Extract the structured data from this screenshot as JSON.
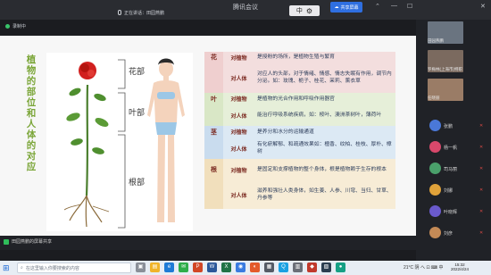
{
  "window": {
    "title": "腾讯会议",
    "speaking": "正在讲话：田园燕鹏",
    "mini_bar_char": "中",
    "share_label": "共享屏幕"
  },
  "sidebar_ctrl": "录制中",
  "slide": {
    "title": "植物的部位和人体的对应",
    "tags": [
      "花部",
      "叶部",
      "根部"
    ]
  },
  "table": {
    "rows": [
      {
        "part": "花",
        "sub": "对植物",
        "desc": "是授粉的场所，是植物生殖与繁育"
      },
      {
        "part": "",
        "sub": "对人体",
        "desc": "对应人的头部，对于情绪、情感、情志失眠有作用，调节内分泌。如：玫瑰、栀子、桂花、茉莉、薰衣草"
      },
      {
        "part": "叶",
        "sub": "对植物",
        "desc": "是植物的光合作用和呼吸作用器官"
      },
      {
        "part": "",
        "sub": "对人体",
        "desc": "能治疗呼吸系统疾病，如：桉叶、澳洲茶树叶，薄荷叶"
      },
      {
        "part": "茎",
        "sub": "对植物",
        "desc": "是养分和水分的运输通道"
      },
      {
        "part": "",
        "sub": "对人体",
        "desc": "有化瘀解郁、和疏通效果如：檀香、纹柏、桂枝、厚朴、樟树"
      },
      {
        "part": "根",
        "sub": "对植物",
        "desc": "是固定和支撑植物的整个身体，根是植物赖于生存的根本"
      },
      {
        "part": "",
        "sub": "对人体",
        "desc": "滋养和强壮人类身体，如生姜、人参、川穹、当归、甘草、丹参等"
      }
    ]
  },
  "participants": [
    {
      "name": "田园燕鹏",
      "kind": "video"
    },
    {
      "name": "罗梅林(上海市)特职",
      "kind": "video"
    },
    {
      "name": "任晓丽",
      "kind": "video"
    },
    {
      "name": "张鹏",
      "kind": "avatar",
      "color": "#4a78d8"
    },
    {
      "name": "杨一帆",
      "kind": "avatar",
      "color": "#d8486b"
    },
    {
      "name": "司马丽",
      "kind": "avatar",
      "color": "#4aa06b"
    },
    {
      "name": "刘娜",
      "kind": "avatar",
      "color": "#e0a23a"
    },
    {
      "name": "叶晓辉",
      "kind": "avatar",
      "color": "#6a5acd"
    },
    {
      "name": "刘彦",
      "kind": "avatar",
      "color": "#c48a56"
    }
  ],
  "bottombar": {
    "sharing": "田园燕鹏的屏幕共享"
  },
  "taskbar": {
    "search_placeholder": "在这里输入你要搜索的内容",
    "tray": "21°C 阴  へ ⊡ ⌨ 中",
    "time": "15:32",
    "date": "2022/4/24"
  }
}
